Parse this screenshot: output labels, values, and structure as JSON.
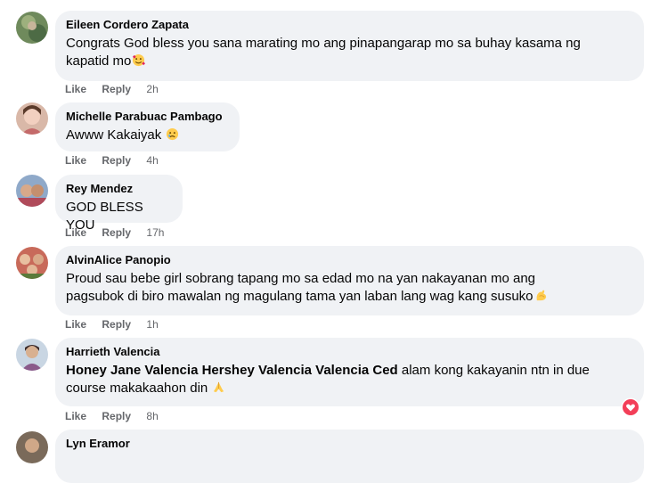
{
  "comments": [
    {
      "author": "Eileen Cordero Zapata",
      "line1": "Congrats God bless you sana marating mo ang pinapangarap mo sa buhay kasama ng",
      "line2": "kapatid mo",
      "emoji": "smiling-face-with-hearts-icon",
      "like": "Like",
      "reply": "Reply",
      "time": "2h"
    },
    {
      "author": "Michelle Parabuac Pambago",
      "line1": "Awww Kakaiyak",
      "emoji": "crying-face-icon",
      "like": "Like",
      "reply": "Reply",
      "time": "4h"
    },
    {
      "author": "Rey Mendez",
      "line1": "GOD BLESS YOU",
      "like": "Like",
      "reply": "Reply",
      "time": "17h"
    },
    {
      "author": "AlvinAlice Panopio",
      "line1": "Proud sau bebe girl sobrang tapang mo sa edad mo na yan nakayanan mo ang",
      "line2": "pagsubok di biro mawalan ng magulang tama yan laban lang wag kang susuko",
      "emoji": "flexed-biceps-icon",
      "like": "Like",
      "reply": "Reply",
      "time": "1h"
    },
    {
      "author": "Harrieth Valencia",
      "tags": "Honey Jane Valencia Hershey Valencia Valencia Ced",
      "line1_rest": " alam kong kakayanin ntn in due",
      "line2": "course makakaahon din ",
      "emoji": "folded-hands-icon",
      "like": "Like",
      "reply": "Reply",
      "time": "8h"
    },
    {
      "author": "Lyn Eramor"
    }
  ],
  "colors": {
    "bubble": "#f0f2f5",
    "meta": "#65676b",
    "love": "#f33e58"
  }
}
